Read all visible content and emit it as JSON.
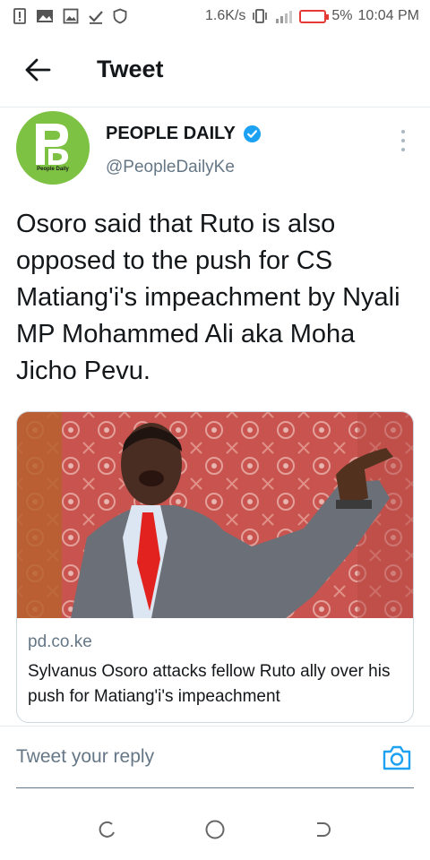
{
  "status_bar": {
    "net_speed": "1.6K/s",
    "battery_percent": "5%",
    "time": "10:04 PM",
    "icons": [
      "alert-icon",
      "photo-icon",
      "gallery-icon",
      "check-icon",
      "shield-icon",
      "vibrate-icon",
      "signal-icon",
      "battery-icon"
    ]
  },
  "header": {
    "title": "Tweet",
    "back_icon": "arrow-left-icon"
  },
  "tweet": {
    "author": {
      "name": "PEOPLE DAILY",
      "handle": "@PeopleDailyKe",
      "avatar_caption": "People Daily",
      "verified": true,
      "avatar_color": "#7dc242"
    },
    "text": "Osoro said that Ruto is also opposed to the push for CS Matiang'i's impeachment by Nyali MP Mohammed Ali aka Moha Jicho Pevu.",
    "link_card": {
      "domain": "pd.co.ke",
      "title": "Sylvanus Osoro attacks fellow Ruto ally over his push for Matiang'i's impeachment",
      "image_desc_icon": "photo-thumbnail"
    }
  },
  "reply": {
    "placeholder": "Tweet your reply",
    "camera_icon": "camera-icon"
  },
  "nav": {
    "items": [
      "recents-icon",
      "home-icon",
      "back-icon"
    ]
  },
  "colors": {
    "accent": "#1da1f2",
    "text_primary": "#14171a",
    "text_secondary": "#657786",
    "battery_low": "#e53935"
  }
}
